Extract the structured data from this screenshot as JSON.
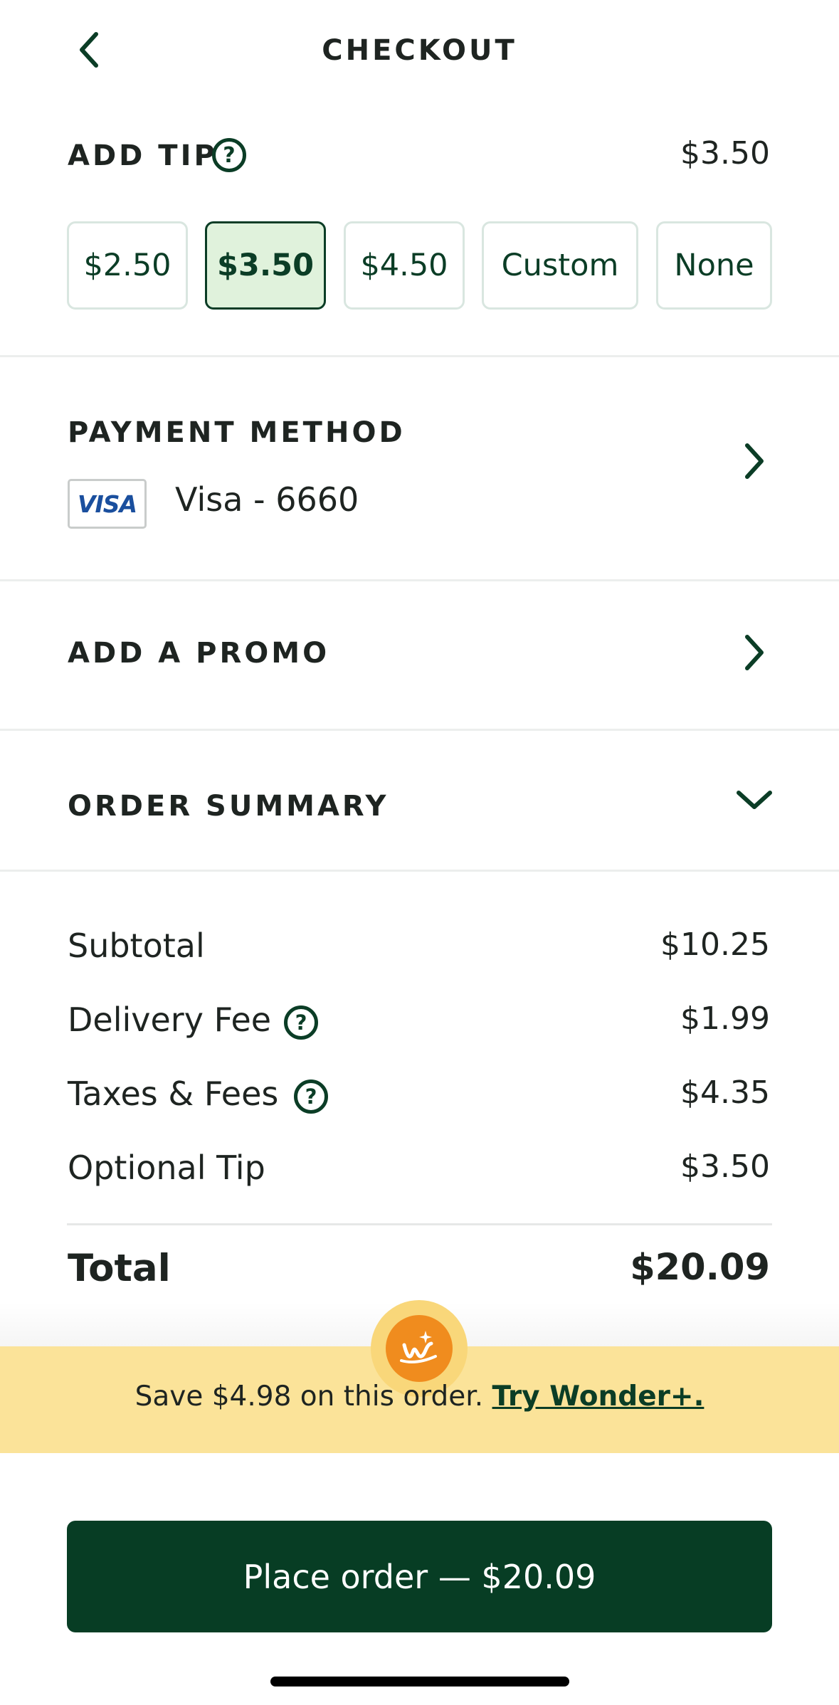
{
  "header": {
    "title": "CHECKOUT",
    "back_icon": "chevron-left-icon"
  },
  "tip": {
    "heading": "ADD TIP",
    "selected_amount": "$3.50",
    "options": [
      {
        "label": "$2.50",
        "selected": false
      },
      {
        "label": "$3.50",
        "selected": true
      },
      {
        "label": "$4.50",
        "selected": false
      },
      {
        "label": "Custom",
        "selected": false
      },
      {
        "label": "None",
        "selected": false
      }
    ]
  },
  "payment": {
    "heading": "PAYMENT METHOD",
    "card_brand": "VISA",
    "card_label": "Visa - 6660"
  },
  "promo": {
    "heading": "ADD A PROMO"
  },
  "order_summary": {
    "heading": "ORDER SUMMARY",
    "rows": [
      {
        "label": "Subtotal",
        "value": "$10.25",
        "help": false
      },
      {
        "label": "Delivery Fee",
        "value": "$1.99",
        "help": true
      },
      {
        "label": "Taxes & Fees",
        "value": "$4.35",
        "help": true
      },
      {
        "label": "Optional Tip",
        "value": "$3.50",
        "help": false
      }
    ],
    "total_label": "Total",
    "total_value": "$20.09"
  },
  "banner": {
    "text": "Save $4.98 on this order.",
    "link": "Try Wonder+."
  },
  "place_order": {
    "label": "Place order — $20.09"
  },
  "colors": {
    "brand_green": "#073d24",
    "selected_chip_bg": "#e0f2dc",
    "banner_bg": "#fbe399",
    "badge_orange": "#f08c1e"
  }
}
